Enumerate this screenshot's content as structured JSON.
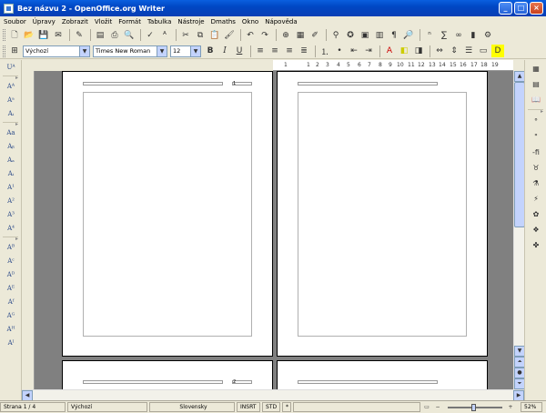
{
  "window": {
    "title": "Bez názvu 2 - OpenOffice.org Writer"
  },
  "menubar": [
    "Soubor",
    "Úpravy",
    "Zobrazit",
    "Vložit",
    "Formát",
    "Tabulka",
    "Nástroje",
    "Dmaths",
    "Okno",
    "Nápověda"
  ],
  "formatting": {
    "style": "Výchozí",
    "font": "Times New Roman",
    "size": "12",
    "bold": "B",
    "italic": "I",
    "underline": "U"
  },
  "ruler": {
    "ticks": [
      "1",
      "1",
      "2",
      "3",
      "4",
      "5",
      "6",
      "7",
      "8",
      "9",
      "10",
      "11",
      "12",
      "13",
      "14",
      "15",
      "16",
      "17",
      "18",
      "19"
    ]
  },
  "pages": {
    "header_number_left": "1",
    "header_number_bottom": "2"
  },
  "statusbar": {
    "page": "Strana 1 / 4",
    "style": "Výchozí",
    "language": "Slovensky",
    "insert": "INSRT",
    "selection": "STD",
    "modified": "*",
    "zoom": "52%"
  },
  "icons": {
    "new": "new-document-icon",
    "open": "open-icon",
    "save": "save-icon",
    "print": "print-icon",
    "spellcheck": "spellcheck-icon",
    "cut": "cut-icon",
    "copy": "copy-icon",
    "paste": "paste-icon",
    "undo": "undo-icon",
    "redo": "redo-icon",
    "navigator": "navigator-icon",
    "gallery": "gallery-icon"
  }
}
